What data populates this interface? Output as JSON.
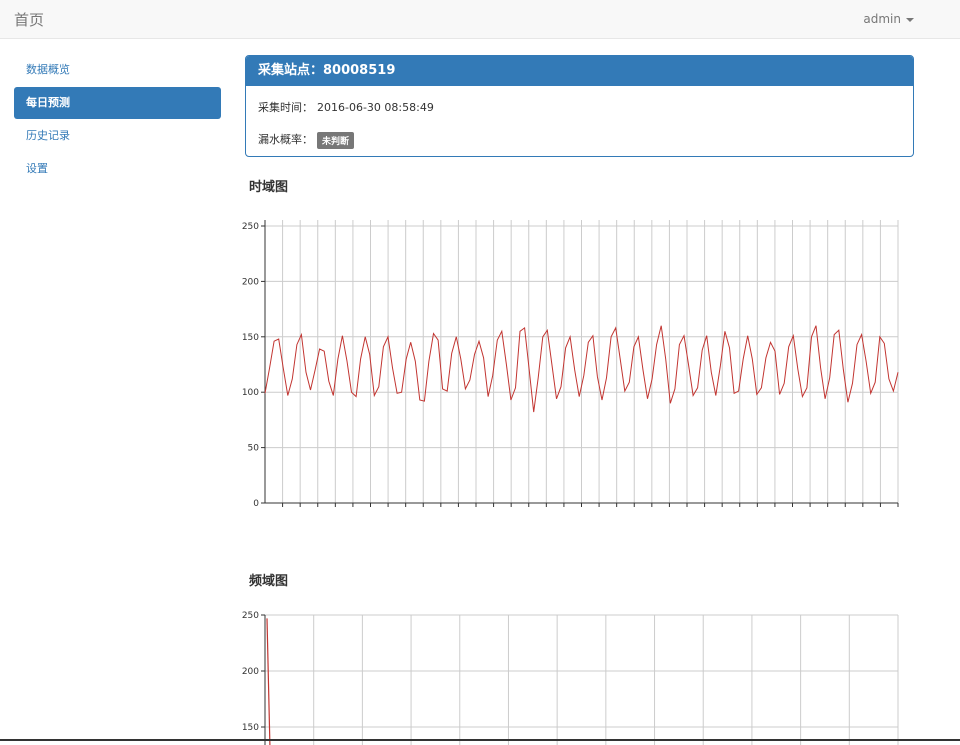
{
  "navbar": {
    "brand": "首页",
    "user": "admin"
  },
  "sidebar": {
    "items": [
      {
        "label": "数据概览",
        "active": false
      },
      {
        "label": "每日预测",
        "active": true
      },
      {
        "label": "历史记录",
        "active": false
      },
      {
        "label": "设置",
        "active": false
      }
    ]
  },
  "panel": {
    "title": "采集站点：80008519",
    "time_label": "采集时间：",
    "time_value": "2016-06-30 08:58:49",
    "prob_label": "漏水概率：",
    "prob_badge": "未判断"
  },
  "chart_time": {
    "title": "时域图"
  },
  "chart_freq": {
    "title": "频域图"
  },
  "chart_data": [
    {
      "type": "line",
      "ylim": [
        0,
        250
      ],
      "yticks": [
        0,
        50,
        100,
        150,
        200,
        250
      ],
      "series": [
        {
          "color": "#c23531",
          "values": [
            99,
            122,
            146,
            148,
            122,
            97,
            112,
            143,
            152,
            118,
            102,
            120,
            139,
            137,
            110,
            97,
            130,
            151,
            128,
            100,
            96,
            130,
            150,
            134,
            97,
            105,
            141,
            150,
            122,
            99,
            100,
            130,
            145,
            128,
            93,
            92,
            128,
            153,
            147,
            103,
            101,
            135,
            150,
            130,
            103,
            111,
            134,
            146,
            131,
            96,
            115,
            147,
            155,
            125,
            93,
            104,
            155,
            158,
            121,
            82,
            113,
            150,
            156,
            125,
            94,
            105,
            140,
            150,
            120,
            96,
            115,
            145,
            151,
            114,
            93,
            113,
            150,
            158,
            130,
            101,
            109,
            141,
            150,
            120,
            94,
            112,
            143,
            160,
            130,
            90,
            103,
            143,
            151,
            125,
            97,
            104,
            138,
            151,
            118,
            97,
            124,
            155,
            140,
            99,
            101,
            130,
            151,
            130,
            98,
            104,
            131,
            145,
            137,
            98,
            108,
            141,
            151,
            121,
            96,
            104,
            150,
            160,
            122,
            94,
            113,
            152,
            156,
            120,
            91,
            108,
            143,
            152,
            128,
            99,
            109,
            150,
            144,
            112,
            101,
            118
          ]
        }
      ]
    },
    {
      "type": "line",
      "ylim_visible": [
        140,
        250
      ],
      "yticks": [
        150,
        200,
        250
      ],
      "series": [
        {
          "color": "#c23531",
          "values": [
            247,
            130
          ]
        }
      ]
    }
  ]
}
